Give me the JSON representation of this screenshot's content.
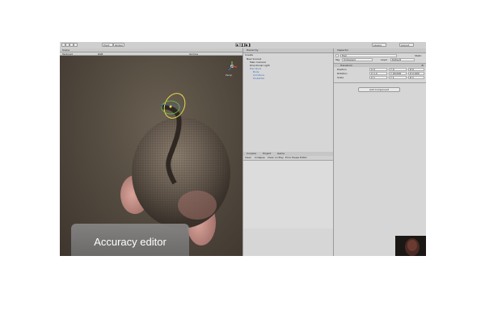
{
  "toolbar": {
    "pivot_label": "Pivot",
    "global_label": "Global",
    "layers_label": "Layers",
    "layout_label": "Layout"
  },
  "scene": {
    "tab_label": "Scene",
    "shading_label": "Textured",
    "rgb_label": "RGB",
    "gizmos_label": "Gizmos",
    "persp_label": "Persp",
    "caption": "Accuracy editor"
  },
  "hierarchy": {
    "tab_label": "Hierarchy",
    "create_label": "Create",
    "items": [
      "New Scene1",
      "Main Camera",
      "Directional Light",
      "Hair Root",
      "Body",
      "Armature",
      "ProbeHat"
    ]
  },
  "console": {
    "tabs": [
      "Console",
      "Project",
      "Game"
    ],
    "buttons": [
      "Clear",
      "Collapse",
      "Clear on Play",
      "Error Pause",
      "Editor"
    ]
  },
  "inspector": {
    "tab_label": "Inspector",
    "object_name": "Hair",
    "static_label": "Static",
    "tag_label": "Tag",
    "tag_value": "Untagged",
    "layer_label": "Layer",
    "layer_value": "Default",
    "component_title": "Transform",
    "position_label": "Position",
    "rotation_label": "Rotation",
    "scale_label": "Scale",
    "position": [
      "X 0",
      "Y 0",
      "Z 0"
    ],
    "rotation": [
      "X 1.2",
      "Y 90.000",
      "Z 0.000"
    ],
    "scale": [
      "X 1",
      "Y 1",
      "Z 1"
    ],
    "add_component_label": "Add Component"
  },
  "colors": {
    "editor_bg": "#c2c2c2",
    "scene_bg": "#4a4138",
    "gizmo_yellow": "#e8d84a",
    "gizmo_green": "#6bc44d",
    "selection_blue": "#3d6fb6"
  }
}
